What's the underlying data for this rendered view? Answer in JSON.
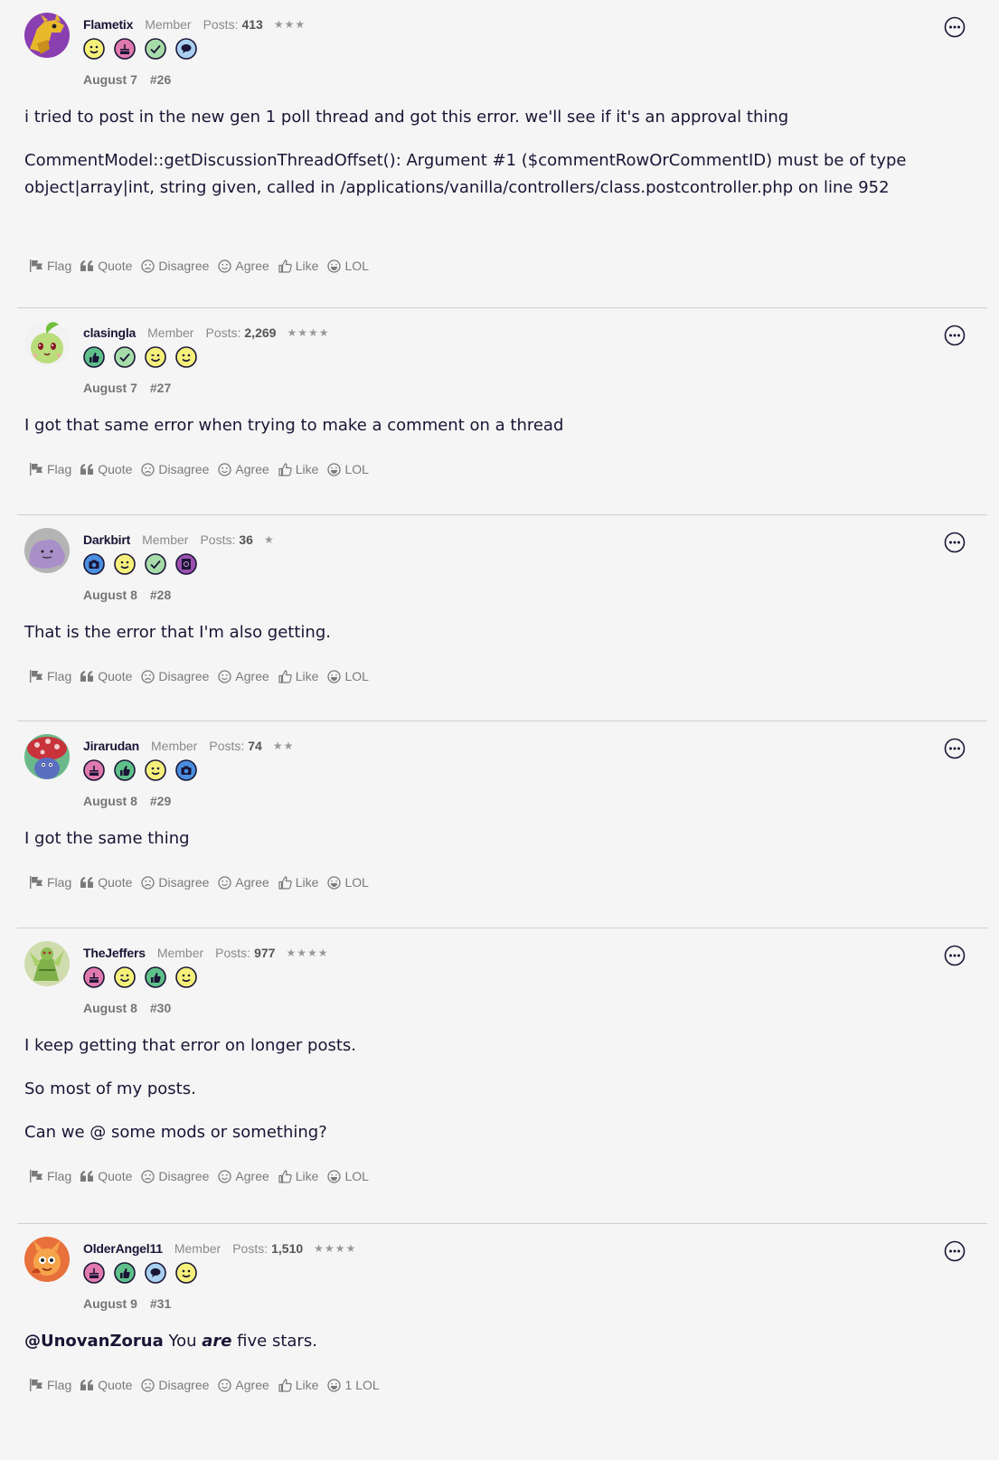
{
  "actions": {
    "flag": "Flag",
    "quote": "Quote",
    "disagree": "Disagree",
    "agree": "Agree",
    "like": "Like",
    "lol": "LOL"
  },
  "posts_label": "Posts:",
  "posts": [
    {
      "username": "Flametix",
      "role": "Member",
      "post_count": "413",
      "rank_stars": "★★★",
      "badges": [
        "smile-badge",
        "cake-badge",
        "check-badge",
        "speech-badge"
      ],
      "date": "August 7",
      "number": "#26",
      "paragraphs": [
        "i tried to post in the new gen 1 poll thread and got this error. we'll see if it's an approval thing",
        "CommentModel::getDiscussionThreadOffset(): Argument #1 ($commentRowOrCommentID) must be of type object|array|int, string given, called in /applications/vanilla/controllers/class.postcontroller.php on line 952"
      ],
      "lol_count": ""
    },
    {
      "username": "clasingla",
      "role": "Member",
      "post_count": "2,269",
      "rank_stars": "★★★★",
      "badges": [
        "thumbs-up-badge",
        "check-badge",
        "wink-badge",
        "smile-badge"
      ],
      "date": "August 7",
      "number": "#27",
      "paragraphs": [
        "I got that same error when trying to make a comment on a thread"
      ],
      "lol_count": ""
    },
    {
      "username": "Darkbirt",
      "role": "Member",
      "post_count": "36",
      "rank_stars": "★",
      "badges": [
        "camera-badge",
        "smile-badge",
        "check-badge",
        "at-sign-badge"
      ],
      "date": "August 8",
      "number": "#28",
      "paragraphs": [
        "That is the error that I'm also getting."
      ],
      "lol_count": ""
    },
    {
      "username": "Jirarudan",
      "role": "Member",
      "post_count": "74",
      "rank_stars": "★★",
      "badges": [
        "cake-badge",
        "thumbs-up-badge",
        "smile-badge",
        "camera-badge"
      ],
      "date": "August 8",
      "number": "#29",
      "paragraphs": [
        "I got the same thing"
      ],
      "lol_count": ""
    },
    {
      "username": "TheJeffers",
      "role": "Member",
      "post_count": "977",
      "rank_stars": "★★★★",
      "badges": [
        "cake-badge",
        "wink-badge",
        "thumbs-up-badge",
        "smile-badge"
      ],
      "date": "August 8",
      "number": "#30",
      "paragraphs": [
        "I keep getting that error on longer posts.",
        "So most of my posts.",
        "Can we @ some mods or something?"
      ],
      "lol_count": ""
    },
    {
      "username": "OlderAngel11",
      "role": "Member",
      "post_count": "1,510",
      "rank_stars": "★★★★",
      "badges": [
        "cake-badge",
        "thumbs-up-badge",
        "speech-badge",
        "smile-badge"
      ],
      "date": "August 9",
      "number": "#31",
      "mention": "@UnovanZorua",
      "rich_parts": [
        " You ",
        "are",
        " five stars."
      ],
      "lol_count": "1"
    }
  ]
}
